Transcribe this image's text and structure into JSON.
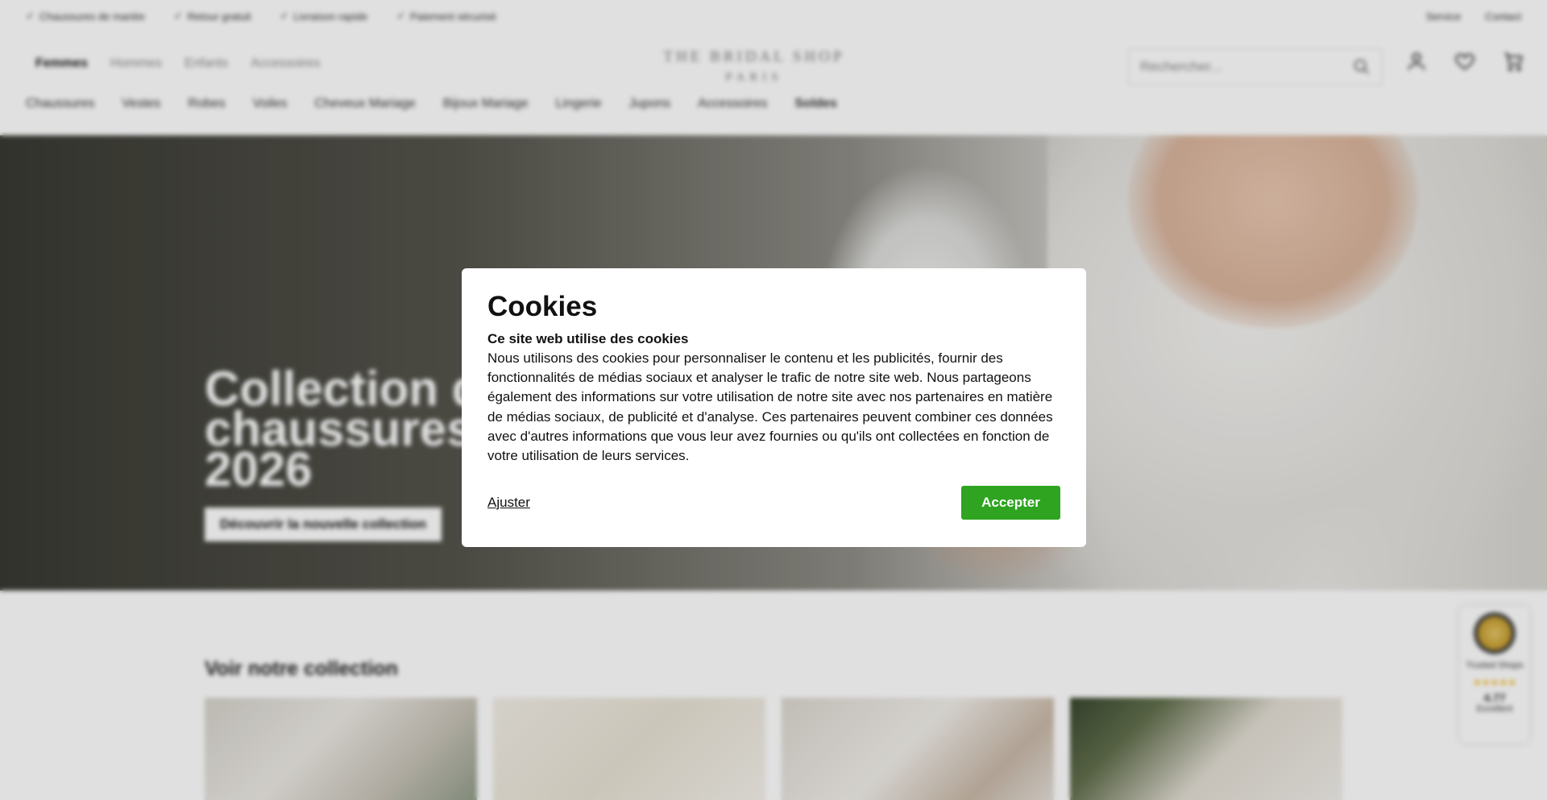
{
  "topbar": {
    "usps": [
      "Chaussures de mariée",
      "Retour gratuit",
      "Livraison rapide",
      "Paiement sécurisé"
    ],
    "links": [
      "Service",
      "Contact"
    ]
  },
  "header": {
    "gender_tabs": [
      "Femmes",
      "Hommes",
      "Enfants",
      "Accessoires"
    ],
    "logo_line1": "THE BRIDAL SHOP",
    "logo_line2": "PARIS",
    "search_placeholder": "Rechercher...",
    "icons": [
      "account-icon",
      "heart-icon",
      "cart-icon"
    ]
  },
  "category_nav": [
    "Chaussures",
    "Vestes",
    "Robes",
    "Voiles",
    "Cheveux Mariage",
    "Bijoux Mariage",
    "Lingerie",
    "Jupons",
    "Accessoires",
    "Soldes"
  ],
  "hero": {
    "title_lines": [
      "Collection de",
      "chaussures de",
      "2026"
    ],
    "button_label": "Découvrir la nouvelle collection"
  },
  "collection": {
    "title": "Voir notre collection",
    "tiles": [
      "t1",
      "t2",
      "t3",
      "t4"
    ]
  },
  "trust_badge": {
    "label": "Trusted Shops",
    "stars": "★★★★★",
    "score": "4.77",
    "caption": "Excellent"
  },
  "cookie_modal": {
    "title": "Cookies",
    "subtitle": "Ce site web utilise des cookies",
    "body": "Nous utilisons des cookies pour personnaliser le contenu et les publicités, fournir des fonctionnalités de médias sociaux et analyser le trafic de notre site web. Nous partageons également des informations sur votre utilisation de notre site avec nos partenaires en matière de médias sociaux, de publicité et d'analyse. Ces partenaires peuvent combiner ces données avec d'autres informations que vous leur avez fournies ou qu'ils ont collectées en fonction de votre utilisation de leurs services.",
    "adjust_label": "Ajuster",
    "accept_label": "Accepter",
    "accept_color": "#2ea421"
  }
}
